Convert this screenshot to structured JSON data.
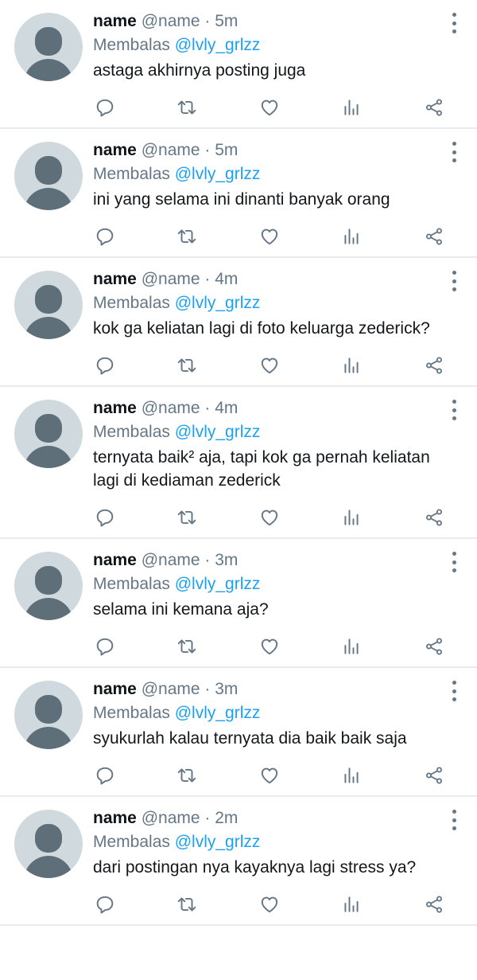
{
  "tweets": [
    {
      "name": "name",
      "handle": "@name",
      "time": "5m",
      "reply_prefix": "Membalas",
      "reply_to": "@lvly_grlzz",
      "text": "astaga akhirnya posting juga"
    },
    {
      "name": "name",
      "handle": "@name",
      "time": "5m",
      "reply_prefix": "Membalas",
      "reply_to": "@lvly_grlzz",
      "text": "ini yang selama ini dinanti banyak orang"
    },
    {
      "name": "name",
      "handle": "@name",
      "time": "4m",
      "reply_prefix": "Membalas",
      "reply_to": "@lvly_grlzz",
      "text": "kok ga keliatan lagi di foto keluarga zederick?"
    },
    {
      "name": "name",
      "handle": "@name",
      "time": "4m",
      "reply_prefix": "Membalas",
      "reply_to": "@lvly_grlzz",
      "text": "ternyata baik² aja, tapi kok ga pernah keliatan lagi di kediaman zederick"
    },
    {
      "name": "name",
      "handle": "@name",
      "time": "3m",
      "reply_prefix": "Membalas",
      "reply_to": "@lvly_grlzz",
      "text": "selama ini kemana aja?"
    },
    {
      "name": "name",
      "handle": "@name",
      "time": "3m",
      "reply_prefix": "Membalas",
      "reply_to": "@lvly_grlzz",
      "text": "syukurlah kalau ternyata dia baik baik saja"
    },
    {
      "name": "name",
      "handle": "@name",
      "time": "2m",
      "reply_prefix": "Membalas",
      "reply_to": "@lvly_grlzz",
      "text": "dari postingan nya kayaknya lagi stress ya?"
    }
  ],
  "separator": "·",
  "icons": {
    "reply": "reply-icon",
    "retweet": "retweet-icon",
    "like": "heart-icon",
    "stats": "stats-icon",
    "share": "share-icon",
    "more": "more-vertical-icon",
    "avatar": "default-avatar-icon"
  },
  "colors": {
    "link": "#1da1f2",
    "muted": "#657786",
    "divider": "#e6ecf0",
    "avatar_bg": "#cfd9de",
    "avatar_fg": "#5f6f7a"
  }
}
